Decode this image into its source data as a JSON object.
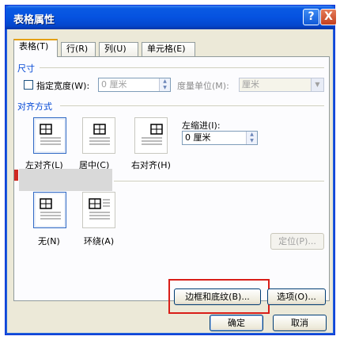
{
  "window": {
    "title": "表格属性",
    "help_label": "?",
    "close_label": "X"
  },
  "tabs": [
    {
      "label": "表格(T)",
      "active": true
    },
    {
      "label": "行(R)",
      "active": false
    },
    {
      "label": "列(U)",
      "active": false
    },
    {
      "label": "单元格(E)",
      "active": false
    }
  ],
  "size_section": {
    "title": "尺寸",
    "specify_width_label": "指定宽度(W):",
    "width_value": "0 厘米",
    "unit_label": "度量单位(M):",
    "unit_value": "厘米"
  },
  "alignment_section": {
    "title": "对齐方式",
    "options": [
      {
        "label": "左对齐(L)",
        "icon": "align-left-icon",
        "selected": true
      },
      {
        "label": "居中(C)",
        "icon": "align-center-icon",
        "selected": false
      },
      {
        "label": "右对齐(H)",
        "icon": "align-right-icon",
        "selected": false
      }
    ],
    "indent_label": "左缩进(I):",
    "indent_value": "0 厘米"
  },
  "wrap_section": {
    "options": [
      {
        "label": "无(N)",
        "icon": "wrap-none-icon",
        "selected": true
      },
      {
        "label": "环绕(A)",
        "icon": "wrap-around-icon",
        "selected": false
      }
    ],
    "position_label": "定位(P)..."
  },
  "buttons": {
    "borders_shading": "边框和底纹(B)...",
    "options": "选项(O)...",
    "ok": "确定",
    "cancel": "取消"
  },
  "colors": {
    "highlight": "#d91e18",
    "accent": "#0046d5"
  }
}
